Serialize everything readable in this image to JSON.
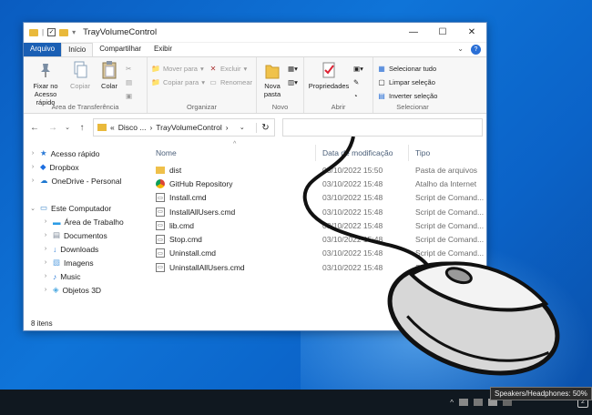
{
  "window": {
    "title": "TrayVolumeControl"
  },
  "tabs": {
    "file": "Arquivo",
    "home": "Início",
    "share": "Compartilhar",
    "view": "Exibir"
  },
  "ribbon": {
    "clipboard": {
      "label": "Área de Transferência",
      "pin": "Fixar no Acesso rápido",
      "copy": "Copiar",
      "paste": "Colar"
    },
    "organize": {
      "label": "Organizar",
      "move": "Mover para",
      "copy_to": "Copiar para",
      "delete": "Excluir",
      "rename": "Renomear"
    },
    "new": {
      "label": "Novo",
      "new_folder": "Nova pasta"
    },
    "open": {
      "label": "Abrir",
      "properties": "Propriedades"
    },
    "select": {
      "label": "Selecionar",
      "select_all": "Selecionar tudo",
      "clear": "Limpar seleção",
      "invert": "Inverter seleção"
    }
  },
  "address": {
    "segments": [
      "«",
      "Disco ...",
      "›",
      "TrayVolumeControl",
      "›"
    ]
  },
  "nav_pane": [
    {
      "label": "Acesso rápido",
      "icon": "star-icon",
      "color": "#2a7ad6",
      "indent": 0
    },
    {
      "label": "Dropbox",
      "icon": "dropbox-icon",
      "color": "#1e6fe0",
      "indent": 0
    },
    {
      "label": "OneDrive - Personal",
      "icon": "cloud-icon",
      "color": "#1c77d0",
      "indent": 0
    },
    {
      "label": "Este Computador",
      "icon": "computer-icon",
      "color": "#3a84c9",
      "indent": 0
    },
    {
      "label": "Área de Trabalho",
      "icon": "desktop-icon",
      "color": "#2b9be5",
      "indent": 1
    },
    {
      "label": "Documentos",
      "icon": "documents-icon",
      "color": "#7b8796",
      "indent": 1
    },
    {
      "label": "Downloads",
      "icon": "download-icon",
      "color": "#2a7ad6",
      "indent": 1
    },
    {
      "label": "Imagens",
      "icon": "pictures-icon",
      "color": "#5aa0e0",
      "indent": 1
    },
    {
      "label": "Music",
      "icon": "music-icon",
      "color": "#2a7ad6",
      "indent": 1
    },
    {
      "label": "Objetos 3D",
      "icon": "3d-objects-icon",
      "color": "#4aa8e0",
      "indent": 1
    }
  ],
  "columns": {
    "name": "Nome",
    "date": "Data de modificação",
    "type": "Tipo"
  },
  "files": [
    {
      "name": "dist",
      "date": "03/10/2022 15:50",
      "type": "Pasta de arquivos",
      "icon": "folder-icon"
    },
    {
      "name": "GitHub Repository",
      "date": "03/10/2022 15:48",
      "type": "Atalho da Internet",
      "icon": "chrome-icon"
    },
    {
      "name": "Install.cmd",
      "date": "03/10/2022 15:48",
      "type": "Script de Comand...",
      "icon": "script-icon"
    },
    {
      "name": "InstallAllUsers.cmd",
      "date": "03/10/2022 15:48",
      "type": "Script de Comand...",
      "icon": "script-icon"
    },
    {
      "name": "lib.cmd",
      "date": "03/10/2022 15:48",
      "type": "Script de Comand...",
      "icon": "script-icon"
    },
    {
      "name": "Stop.cmd",
      "date": "03/10/2022 15:48",
      "type": "Script de Comand...",
      "icon": "script-icon"
    },
    {
      "name": "Uninstall.cmd",
      "date": "03/10/2022 15:48",
      "type": "Script de Comand...",
      "icon": "script-icon"
    },
    {
      "name": "UninstallAllUsers.cmd",
      "date": "03/10/2022 15:48",
      "type": "Script de Comand...",
      "icon": "script-icon"
    }
  ],
  "status": {
    "count": "8 itens"
  },
  "tray": {
    "notification_count": "2",
    "tooltip": "Speakers/Headphones: 50%"
  },
  "colors": {
    "accent": "#1a5fb4",
    "taskbar": "#101820"
  }
}
